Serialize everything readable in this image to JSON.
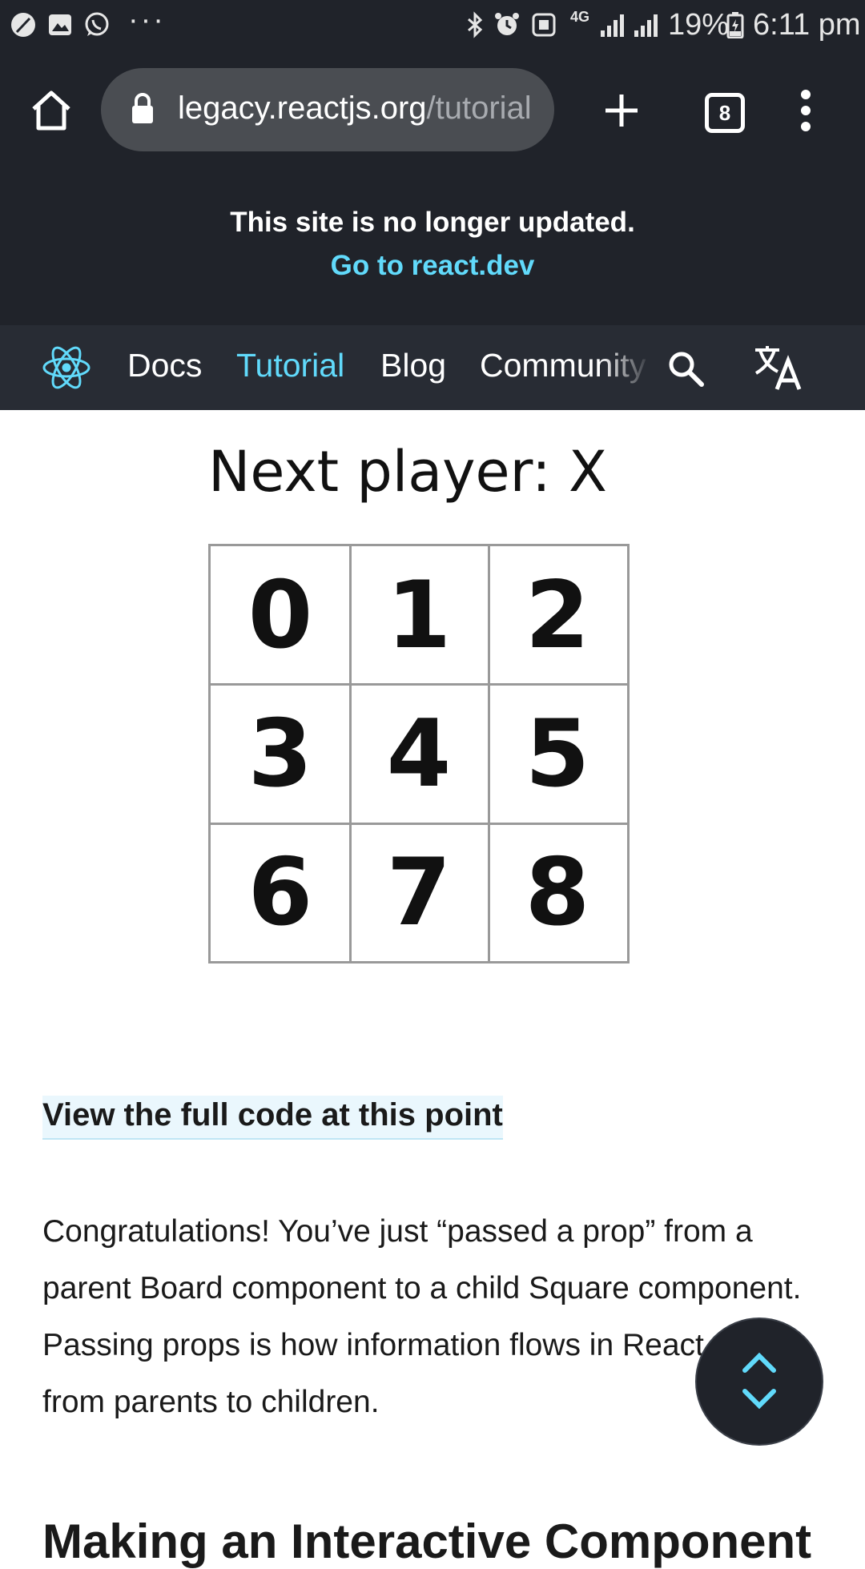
{
  "status_bar": {
    "icons": [
      "leaf-icon",
      "gallery-icon",
      "whatsapp-icon",
      "more-dots-icon",
      "bluetooth-icon",
      "alarm-icon",
      "nfc-icon",
      "network-4g-icon",
      "signal-icon",
      "signal-icon"
    ],
    "overflow": "···",
    "network": "4G",
    "battery": "19%",
    "time": "6:11 pm"
  },
  "browser": {
    "url_host": "legacy.reactjs.org",
    "url_path": "/tutorial",
    "tab_count": "8",
    "icons": [
      "home-icon",
      "lock-icon",
      "new-tab-plus-icon",
      "tabs-icon",
      "overflow-menu-icon"
    ]
  },
  "banner": {
    "message": "This site is no longer updated.",
    "link": "Go to react.dev"
  },
  "site_nav": {
    "items": [
      {
        "label": "Docs",
        "active": false
      },
      {
        "label": "Tutorial",
        "active": true
      },
      {
        "label": "Blog",
        "active": false
      },
      {
        "label": "Community",
        "active": false
      }
    ],
    "icons": [
      "react-logo-icon",
      "search-icon",
      "translate-icon"
    ],
    "accent": "#61dafb",
    "background": "#282c34"
  },
  "game": {
    "status": "Next player: X",
    "squares": [
      "0",
      "1",
      "2",
      "3",
      "4",
      "5",
      "6",
      "7",
      "8"
    ]
  },
  "article": {
    "code_link": "View the full code at this point",
    "paragraph": "Congratulations! You’ve just “passed a prop” from a parent Board component to a child Square component. Passing props is how information flows in React apps, from parents to children.",
    "next_heading": "Making an Interactive Component"
  },
  "fab": {
    "icons": [
      "chevron-up-icon",
      "chevron-down-icon"
    ]
  }
}
